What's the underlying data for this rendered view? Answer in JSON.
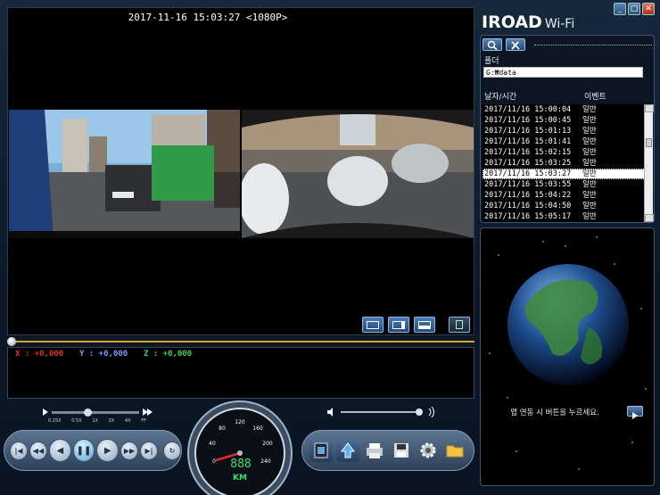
{
  "app": {
    "brand": "IROAD",
    "brand_suffix": "Wi-Fi"
  },
  "window": {
    "min": "_",
    "max": "□",
    "close": "✕"
  },
  "video": {
    "timestamp": "2017-11-16 15:03:27 <1080P>"
  },
  "gsensor": {
    "x": "X : +0,000",
    "y": "Y : +0,000",
    "z": "Z : +0,000"
  },
  "speed": {
    "labels": [
      "0.25X",
      "0.5X",
      "1X",
      "2X",
      "4X",
      "FF"
    ],
    "selected": "1X"
  },
  "gauge": {
    "ticks": [
      "0",
      "40",
      "80",
      "120",
      "160",
      "200",
      "240"
    ],
    "digits": "888",
    "unit": "KM"
  },
  "files": {
    "folder_label": "폴더",
    "folder_path": "G:₩data",
    "col_datetime": "날자/시간",
    "col_event": "이벤트",
    "rows": [
      {
        "datetime": "2017/11/16 15:00:04",
        "event": "일반"
      },
      {
        "datetime": "2017/11/16 15:00:45",
        "event": "일반"
      },
      {
        "datetime": "2017/11/16 15:01:13",
        "event": "일반"
      },
      {
        "datetime": "2017/11/16 15:01:41",
        "event": "일반"
      },
      {
        "datetime": "2017/11/16 15:02:15",
        "event": "일반"
      },
      {
        "datetime": "2017/11/16 15:03:25",
        "event": "일반"
      },
      {
        "datetime": "2017/11/16 15:03:27",
        "event": "일반"
      },
      {
        "datetime": "2017/11/16 15:03:55",
        "event": "일반"
      },
      {
        "datetime": "2017/11/16 15:04:22",
        "event": "일반"
      },
      {
        "datetime": "2017/11/16 15:04:50",
        "event": "일반"
      },
      {
        "datetime": "2017/11/16 15:05:17",
        "event": "일반"
      }
    ],
    "selected_index": 6
  },
  "map": {
    "message": "맵 연동 시 버튼을 누르세요."
  },
  "colors": {
    "accent": "#d8a32a",
    "gx": "#e0302a",
    "gy": "#7f93ff",
    "gz": "#34d25a"
  }
}
